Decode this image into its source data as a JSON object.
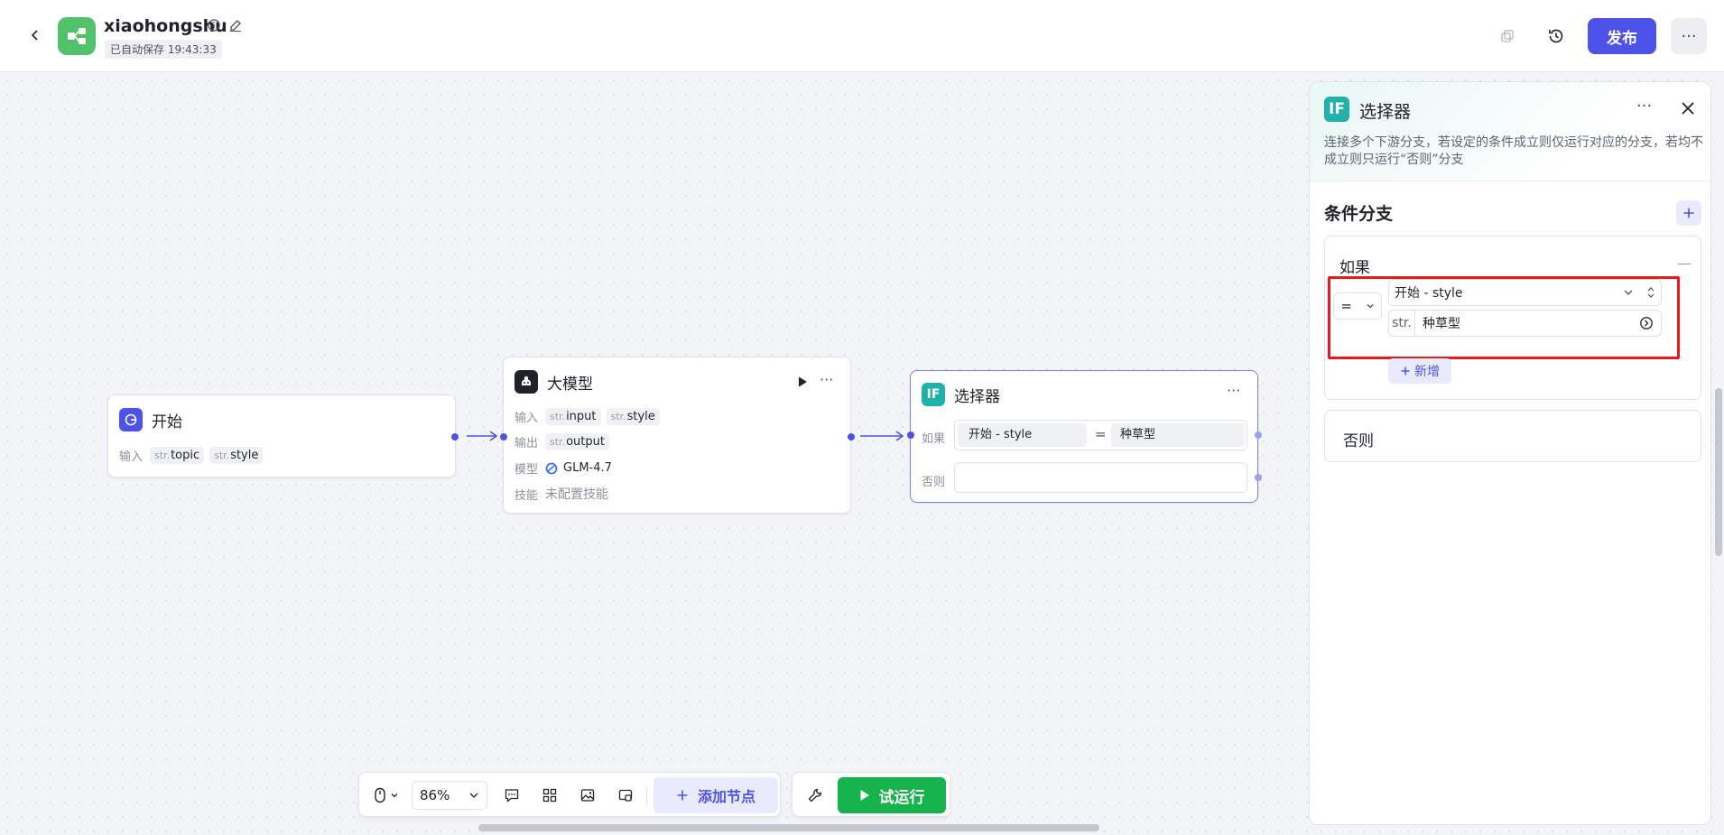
{
  "header": {
    "app_name": "xiaohongshu",
    "autosave": "已自动保存 19:43:33",
    "publish_label": "发布",
    "more_label": "···"
  },
  "nodes": {
    "start": {
      "title": "开始",
      "input_label": "输入",
      "inputs": [
        {
          "type": "str.",
          "name": "topic"
        },
        {
          "type": "str.",
          "name": "style"
        }
      ]
    },
    "llm": {
      "title": "大模型",
      "input_label": "输入",
      "inputs": [
        {
          "type": "str.",
          "name": "input"
        },
        {
          "type": "str.",
          "name": "style"
        }
      ],
      "output_label": "输出",
      "outputs": [
        {
          "type": "str.",
          "name": "output"
        }
      ],
      "model_label": "模型",
      "model": "GLM-4.7",
      "skill_label": "技能",
      "skill": "未配置技能",
      "more_label": "···"
    },
    "selector": {
      "title": "选择器",
      "icon_text": "IF",
      "if_label": "如果",
      "else_label": "否则",
      "cond_var": "开始  -  style",
      "cond_op": "=",
      "cond_value": "种草型",
      "more_label": "···"
    }
  },
  "toolbar": {
    "zoom": "86%",
    "add_node_label": "添加节点",
    "run_label": "试运行"
  },
  "panel": {
    "icon_text": "IF",
    "title": "选择器",
    "more_label": "···",
    "description": "连接多个下游分支，若设定的条件成立则仅运行对应的分支，若均不成立则只运行“否则”分支",
    "section_title": "条件分支",
    "if_label": "如果",
    "operator": "=",
    "variable": "开始 - style",
    "value_type": "str.",
    "value": "种草型",
    "new_label": "新增",
    "else_label": "否则"
  },
  "colors": {
    "accent": "#4d53e8",
    "run_green": "#16b24b",
    "selector_teal": "#20b2aa",
    "highlight_red": "#e8191e"
  }
}
